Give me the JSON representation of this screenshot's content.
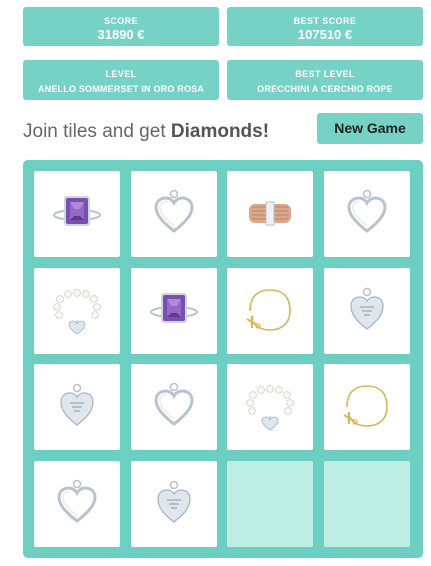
{
  "score": {
    "label": "SCORE",
    "value": "31890 €"
  },
  "best_score": {
    "label": "BEST SCORE",
    "value": "107510 €"
  },
  "level": {
    "label": "LEVEL",
    "value": "ANELLO SOMMERSET IN ORO ROSA"
  },
  "best_level": {
    "label": "BEST LEVEL",
    "value": "ORECCHINI A CERCHIO ROPE"
  },
  "intro": {
    "text": "Join tiles and get ",
    "highlight": "Diamonds!"
  },
  "new_game_label": "New Game",
  "colors": {
    "accent": "#77d2c6",
    "board": "#6ccfc2",
    "empty_tile": "#bdeee3",
    "amethyst": "#7a4fb0",
    "rose_gold": "#d9a88b",
    "gold": "#d7b65a",
    "silver": "#b9c3cc"
  },
  "board": {
    "rows": [
      [
        "amethyst-ring",
        "heart-pendant",
        "rose-gold-ring",
        "heart-pendant"
      ],
      [
        "pearl-bracelet",
        "amethyst-ring",
        "gold-bracelet",
        "heart-tag-pendant"
      ],
      [
        "heart-tag-pendant",
        "heart-pendant",
        "pearl-bracelet",
        "gold-bracelet"
      ],
      [
        "heart-pendant",
        "heart-tag-pendant",
        "empty",
        "empty"
      ]
    ]
  }
}
